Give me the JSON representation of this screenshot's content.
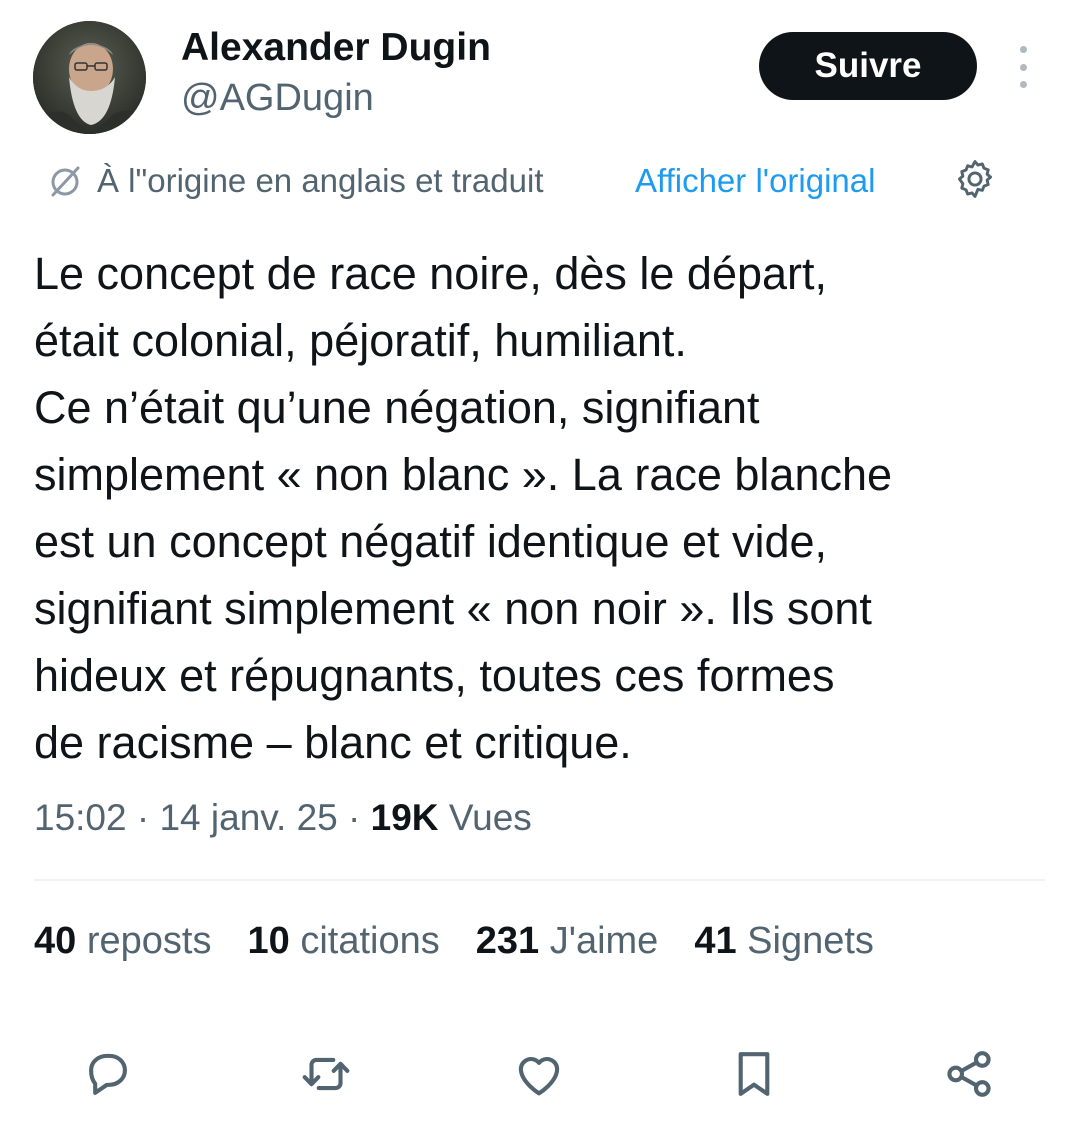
{
  "author": {
    "display_name": "Alexander Dugin",
    "handle": "@AGDugin",
    "avatar_icon": "avatar-photo"
  },
  "follow_button": {
    "label": "Suivre",
    "background": "#0f1419",
    "text_color": "#ffffff"
  },
  "more_menu": {
    "icon": "more-vertical-icon"
  },
  "translation": {
    "icon": "translate-icon",
    "note": "À l\"origine en anglais et traduit",
    "link_label": "Afficher l'original",
    "link_color": "#1d9bf0",
    "settings_icon": "gear-icon"
  },
  "tweet": {
    "text": "Le concept de race noire, dès le départ,\nétait colonial, péjoratif, humiliant.\nCe n’était qu’une négation, signifiant\nsimplement « non blanc ». La race blanche\nest un concept négatif identique et vide,\nsignifiant simplement « non noir ». Ils sont\nhideux et répugnants, toutes ces formes\nde racisme – blanc et critique."
  },
  "meta": {
    "time": "15:02",
    "separator": " · ",
    "date": "14 janv. 25",
    "views_count": "19K",
    "views_label": "Vues"
  },
  "stats": [
    {
      "count": "40",
      "label": "reposts"
    },
    {
      "count": "10",
      "label": "citations"
    },
    {
      "count": "231",
      "label": "J'aime"
    },
    {
      "count": "41",
      "label": "Signets"
    }
  ],
  "actions": [
    {
      "icon": "reply-icon"
    },
    {
      "icon": "repost-icon"
    },
    {
      "icon": "like-icon"
    },
    {
      "icon": "bookmark-icon"
    },
    {
      "icon": "share-icon"
    }
  ],
  "colors": {
    "primary_text": "#0f1419",
    "secondary_text": "#536471",
    "divider": "#eff3f4"
  }
}
